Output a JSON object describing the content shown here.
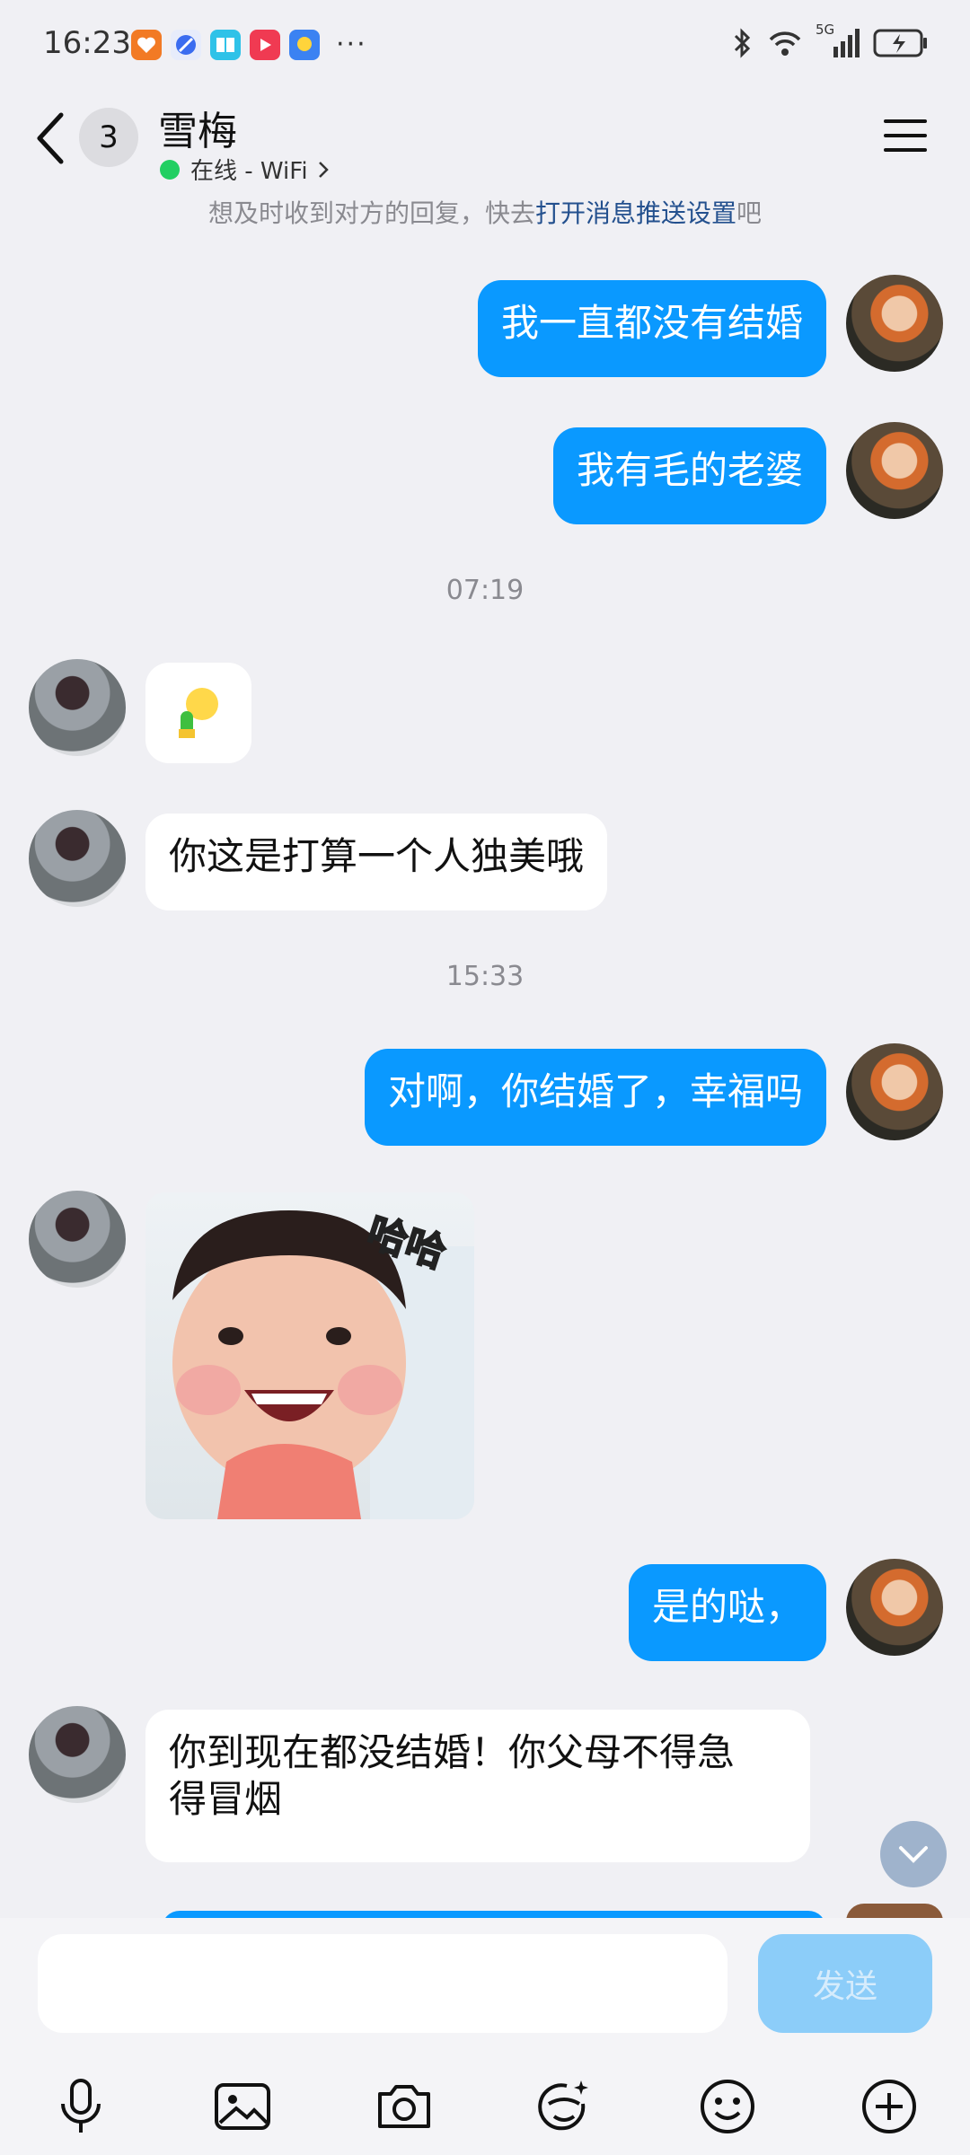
{
  "status": {
    "time": "16:23",
    "more": "···",
    "network": "5G"
  },
  "header": {
    "unread_count": "3",
    "contact_name": "雪梅",
    "presence": "在线 - WiFi",
    "push_tip_prefix": "想及时收到对方的回复，快去",
    "push_tip_link": "打开消息推送设置",
    "push_tip_suffix": "吧"
  },
  "messages": [
    {
      "from": "me",
      "text": "我一直都没有结婚"
    },
    {
      "from": "me",
      "text": "我有毛的老婆"
    },
    {
      "type": "time",
      "text": "07:19"
    },
    {
      "from": "her",
      "type": "emoji",
      "icon": "lightbulb-cactus-emoji"
    },
    {
      "from": "her",
      "text": "你这是打算一个人独美哦"
    },
    {
      "type": "time",
      "text": "15:33"
    },
    {
      "from": "me",
      "text": "对啊，你结婚了，幸福吗"
    },
    {
      "from": "her",
      "type": "sticker",
      "caption": "哈哈"
    },
    {
      "from": "me",
      "text": "是的哒，"
    },
    {
      "from": "her",
      "text_line1": "你到现在都没结婚！你父母不得急",
      "text_line2": "得冒烟"
    }
  ],
  "input": {
    "placeholder": "",
    "send_label": "发送"
  },
  "toolbar": [
    "microphone-icon",
    "image-icon",
    "camera-icon",
    "face-edit-icon",
    "emoji-icon",
    "plus-icon"
  ],
  "colors": {
    "my_bubble": "#0a99ff",
    "her_bubble": "#ffffff",
    "background": "#f0f0f4",
    "link": "#23508e",
    "online": "#21cf62",
    "send_disabled": "#8ccdf9"
  }
}
